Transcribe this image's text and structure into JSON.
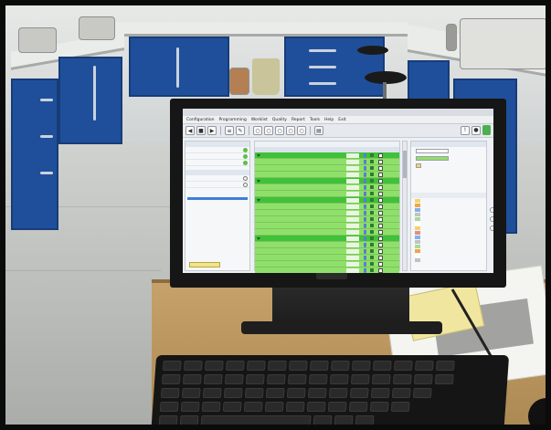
{
  "scene": {
    "description_tag": "photo-of-monitor-on-desk"
  },
  "app": {
    "window_title": "",
    "menu": [
      "Configuration",
      "Programming",
      "Worklist",
      "Quality",
      "Report",
      "Tools",
      "Help",
      "Exit"
    ],
    "left_panel": {
      "title": "",
      "rows": [
        "",
        "",
        ""
      ],
      "second_title": "",
      "second_rows": [
        "",
        ""
      ],
      "footer_label": ""
    },
    "grid": {
      "tabs": [
        "",
        "",
        "",
        "",
        "",
        "",
        ""
      ],
      "headers": [
        "",
        "",
        "",
        "",
        "",
        ""
      ],
      "rows": [
        {
          "type": "group",
          "name": ""
        },
        {
          "type": "item",
          "name": ""
        },
        {
          "type": "item",
          "name": ""
        },
        {
          "type": "item",
          "name": ""
        },
        {
          "type": "group",
          "name": ""
        },
        {
          "type": "item",
          "name": ""
        },
        {
          "type": "item",
          "name": ""
        },
        {
          "type": "group",
          "name": ""
        },
        {
          "type": "item",
          "name": ""
        },
        {
          "type": "item",
          "name": ""
        },
        {
          "type": "item",
          "name": ""
        },
        {
          "type": "item",
          "name": ""
        },
        {
          "type": "item",
          "name": ""
        },
        {
          "type": "group",
          "name": ""
        },
        {
          "type": "item",
          "name": ""
        },
        {
          "type": "item",
          "name": ""
        },
        {
          "type": "item",
          "name": ""
        },
        {
          "type": "item",
          "name": ""
        },
        {
          "type": "item",
          "name": ""
        },
        {
          "type": "group",
          "name": ""
        }
      ]
    },
    "right_panel": {
      "title": "",
      "fields": [
        "",
        "",
        "",
        "",
        "",
        ""
      ],
      "legend_title": "",
      "legend_items": [
        "",
        "",
        "",
        "",
        "",
        "",
        "",
        "",
        "",
        "",
        "",
        "",
        "",
        ""
      ]
    },
    "colors": {
      "group_row": "#3fc13a",
      "item_row": "#8fe06a",
      "cabinet_blue": "#1f4f9a"
    }
  }
}
